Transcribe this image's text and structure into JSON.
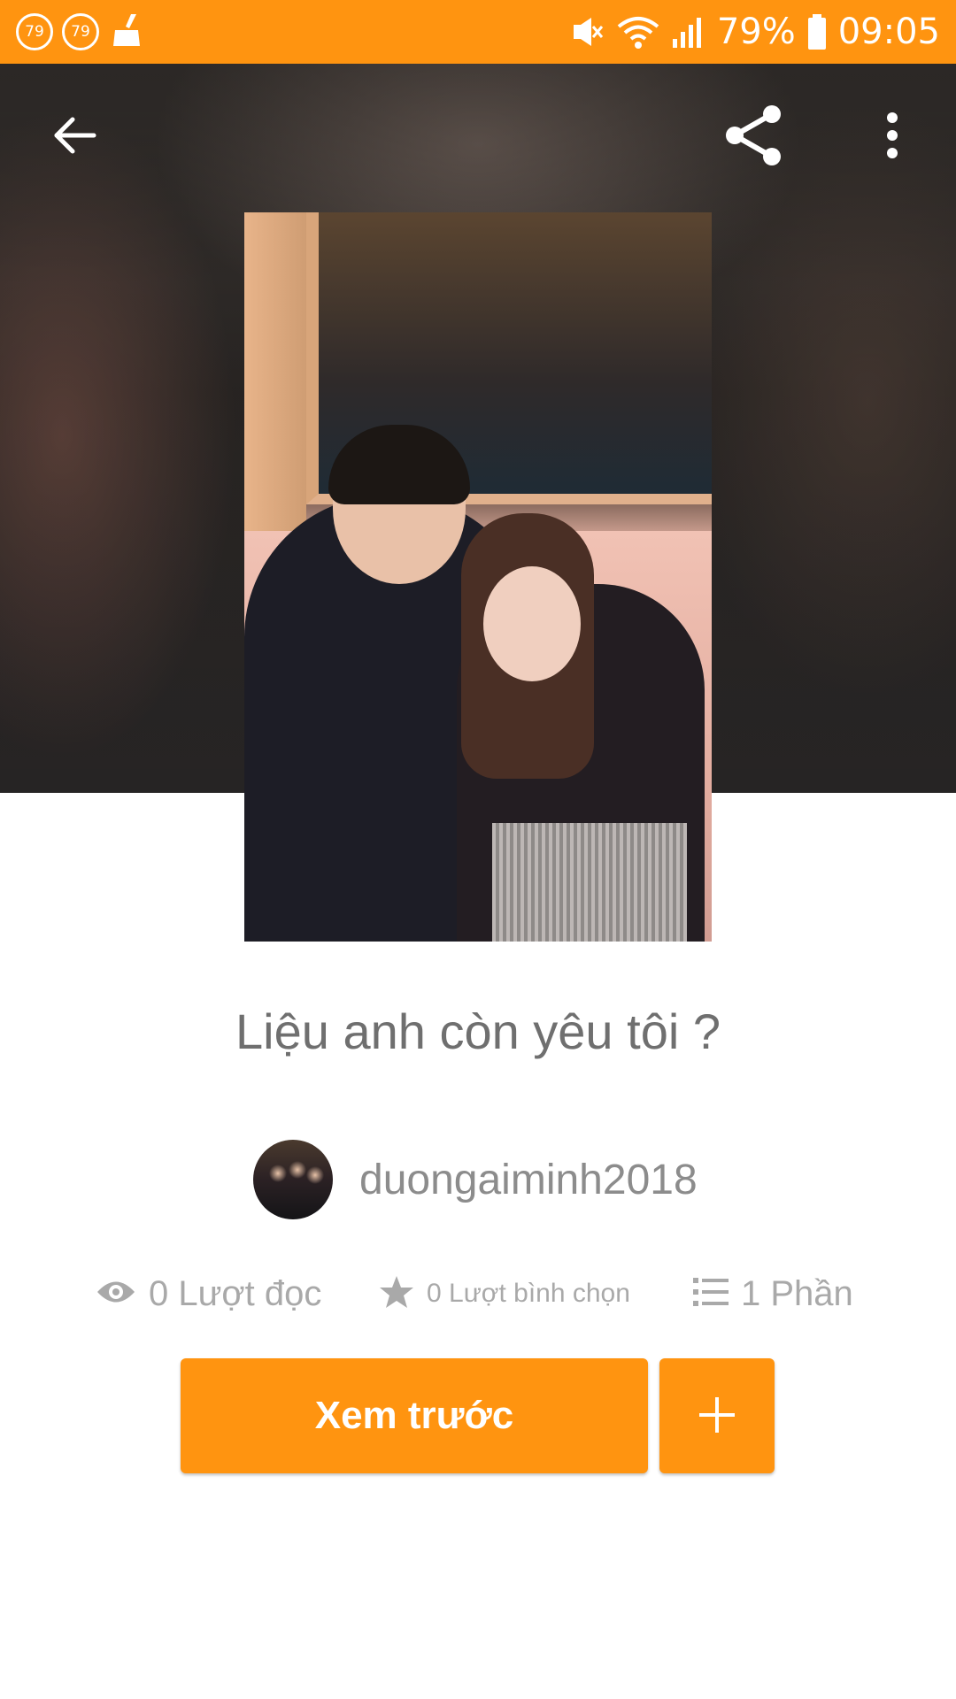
{
  "status_bar": {
    "badge_1": "79",
    "badge_2": "79",
    "battery": "79%",
    "time": "09:05",
    "icons": [
      "notification-badge-icon",
      "cleaner-icon",
      "mute-icon",
      "wifi-icon",
      "signal-icon",
      "battery-icon"
    ]
  },
  "toolbar": {
    "icons": [
      "back-arrow-icon",
      "share-icon",
      "more-vert-icon"
    ]
  },
  "story": {
    "title": "Liệu anh còn yêu tôi ?",
    "author": "duongaiminh2018"
  },
  "stats": {
    "reads": "0 Lượt đọc",
    "votes": "0 Lượt bình chọn",
    "parts": "1 Phần",
    "icons": [
      "eye-icon",
      "star-icon",
      "list-icon"
    ]
  },
  "actions": {
    "read_label": "Xem trước",
    "add_icon": "plus-icon"
  },
  "colors": {
    "accent": "#FF9410",
    "text_primary": "#6f6f6f",
    "text_secondary": "#a9a9a9"
  }
}
